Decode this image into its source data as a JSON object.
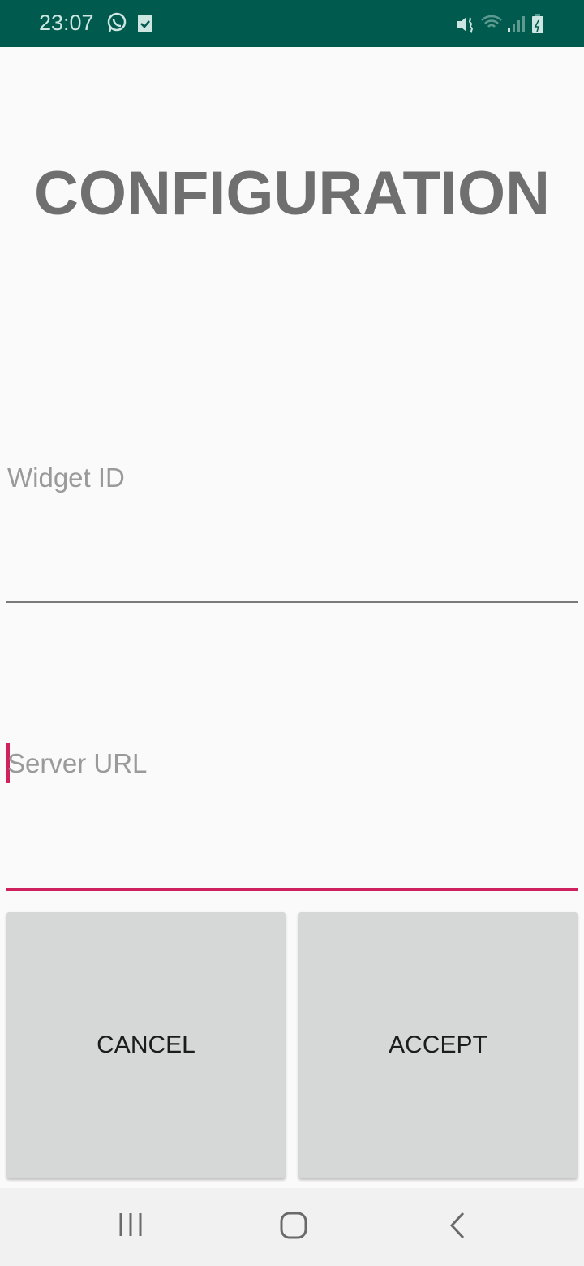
{
  "status_bar": {
    "time": "23:07",
    "left_icons": [
      "whatsapp-icon",
      "task-check-icon"
    ],
    "right_icons": [
      "vibrate-mute-icon",
      "wifi-icon",
      "signal-icon",
      "battery-charging-icon"
    ]
  },
  "title": "CONFIGURATION",
  "widget_id": {
    "placeholder": "Widget ID",
    "value": ""
  },
  "server_url": {
    "placeholder": "Server URL",
    "value": "",
    "focused": true
  },
  "buttons": {
    "cancel": "CANCEL",
    "accept": "ACCEPT"
  },
  "colors": {
    "status_bar": "#005a4e",
    "accent": "#d0215f",
    "button": "#d6d7d7"
  }
}
